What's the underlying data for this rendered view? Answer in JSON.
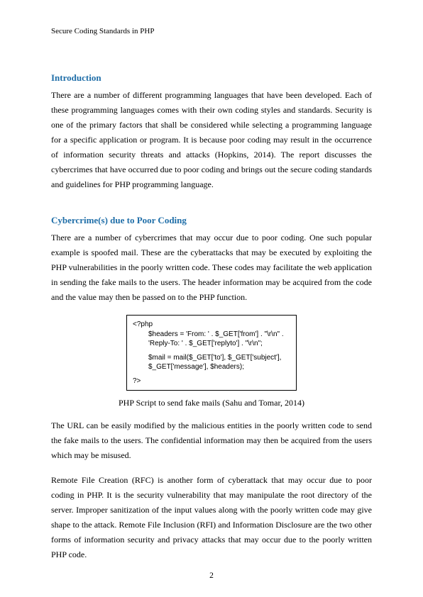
{
  "header": {
    "title": "Secure Coding Standards in PHP"
  },
  "sections": {
    "intro": {
      "heading": "Introduction",
      "para": "There are a number of different programming languages that have been developed. Each of these programming languages comes with their own coding styles and standards. Security is one of the primary factors that shall be considered while selecting a programming language for a specific application or program. It is because poor coding may result in the occurrence of information security threats and attacks (Hopkins, 2014). The report discusses the cybercrimes that have occurred due to poor coding and brings out the secure coding standards and guidelines for PHP programming language."
    },
    "cyber": {
      "heading": "Cybercrime(s) due to Poor Coding",
      "para1": "There are a number of cybercrimes that may occur due to poor coding. One such popular example is spoofed mail. These are the cyberattacks that may be executed by exploiting the PHP vulnerabilities in the poorly written code. These codes may facilitate the web application in sending the fake mails to the users. The header information may be acquired from the code and the value may then be passed on to the PHP function.",
      "code": {
        "l1": "<?php",
        "l2": "$headers = 'From: ' . $_GET['from'] . \"\\r\\n\" .",
        "l3": "'Reply-To: ' . $_GET['replyto'] . \"\\r\\n\";",
        "l4": "$mail = mail($_GET['to'], $_GET['subject'],",
        "l5": "$_GET['message'], $headers);",
        "l6": "?>"
      },
      "caption": "PHP Script to send fake mails (Sahu and Tomar, 2014)",
      "para2": "The URL can be easily modified by the malicious entities in the poorly written code to send the fake mails to the users. The confidential information may then be acquired from the users which may be misused.",
      "para3": "Remote File Creation (RFC) is another form of cyberattack that may occur due to poor coding in PHP. It is the security vulnerability that may manipulate the root directory of the server. Improper sanitization of the input values along with the poorly written code may give shape to the attack. Remote File Inclusion (RFI) and Information Disclosure are the two other forms of information security and privacy attacks that may occur due to the poorly written PHP code."
    }
  },
  "page": {
    "number": "2"
  }
}
